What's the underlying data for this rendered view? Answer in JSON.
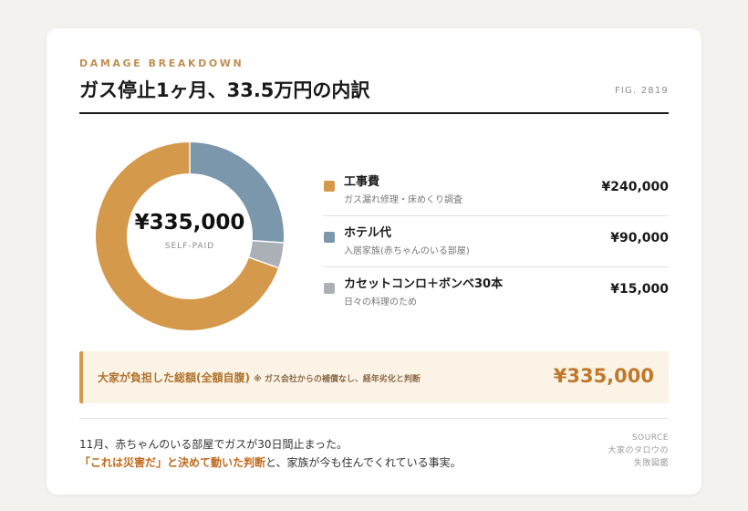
{
  "header": {
    "kicker": "DAMAGE BREAKDOWN",
    "title": "ガス停止1ヶ月、33.5万円の内訳",
    "fig": "FIG. 2819"
  },
  "donut": {
    "total": "¥335,000",
    "caption": "SELF-PAID"
  },
  "chart_data": {
    "type": "pie",
    "categories": [
      "工事費",
      "ホテル代",
      "カセットコンロ＋ボンベ30本"
    ],
    "values": [
      240000,
      90000,
      15000
    ],
    "colors": [
      "#d4994b",
      "#7b97ab",
      "#abafb6"
    ]
  },
  "legend": [
    {
      "label": "工事費",
      "note": "ガス漏れ修理・床めくり調査",
      "amount": "¥240,000",
      "color": "#d4994b"
    },
    {
      "label": "ホテル代",
      "note": "入居家族(赤ちゃんのいる部屋)",
      "amount": "¥90,000",
      "color": "#7b97ab"
    },
    {
      "label": "カセットコンロ＋ボンベ30本",
      "note": "日々の料理のため",
      "amount": "¥15,000",
      "color": "#abafb6"
    }
  ],
  "summary": {
    "label": "大家が負担した総額(全額自腹)",
    "note": "※ ガス会社からの補償なし、経年劣化と判断",
    "amount": "¥335,000"
  },
  "footer": {
    "line1": "11月、赤ちゃんのいる部屋でガスが30日間止まった。",
    "line2_emphasis": "「これは災害だ」と決めて動いた判断",
    "line2_rest": "と、家族が今も住んでくれている事実。",
    "source_label": "SOURCE",
    "source_line1": "大家のタロウの",
    "source_line2": "失敗図鑑"
  }
}
